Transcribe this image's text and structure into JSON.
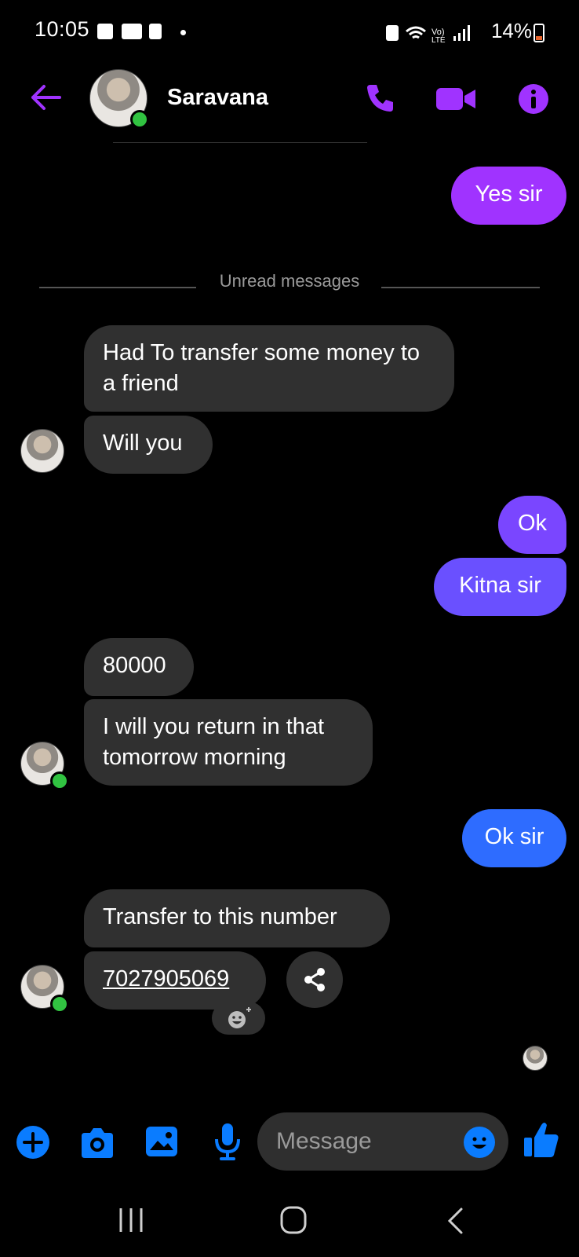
{
  "status_bar": {
    "time": "10:05",
    "battery": "14%",
    "icons": [
      "gallery-icon",
      "voicemail-icon",
      "alert-icon",
      "wifi-icon",
      "volte-icon",
      "signal-icon",
      "battery-icon"
    ]
  },
  "header": {
    "contact_name": "Saravana",
    "online": true,
    "accent_color": "#a033ff"
  },
  "divider": {
    "label": "Unread messages"
  },
  "messages": [
    {
      "from": "me",
      "text": "Yes sir",
      "color": "#a033ff"
    },
    {
      "from": "them",
      "text": "Had To transfer some money to a friend"
    },
    {
      "from": "them",
      "text": "Will you"
    },
    {
      "from": "me",
      "text": "Ok",
      "color": "#7a46ff"
    },
    {
      "from": "me",
      "text": "Kitna sir",
      "color": "#6a50ff"
    },
    {
      "from": "them",
      "text": "80000"
    },
    {
      "from": "them",
      "text": "I will you return in that tomorrow morning"
    },
    {
      "from": "me",
      "text": "Ok sir",
      "color": "#2e6cff"
    },
    {
      "from": "them",
      "text": "Transfer to this number"
    },
    {
      "from": "them",
      "text": "7027905069",
      "type": "link"
    }
  ],
  "composer": {
    "placeholder": "Message",
    "accent_color": "#0a7cff"
  }
}
